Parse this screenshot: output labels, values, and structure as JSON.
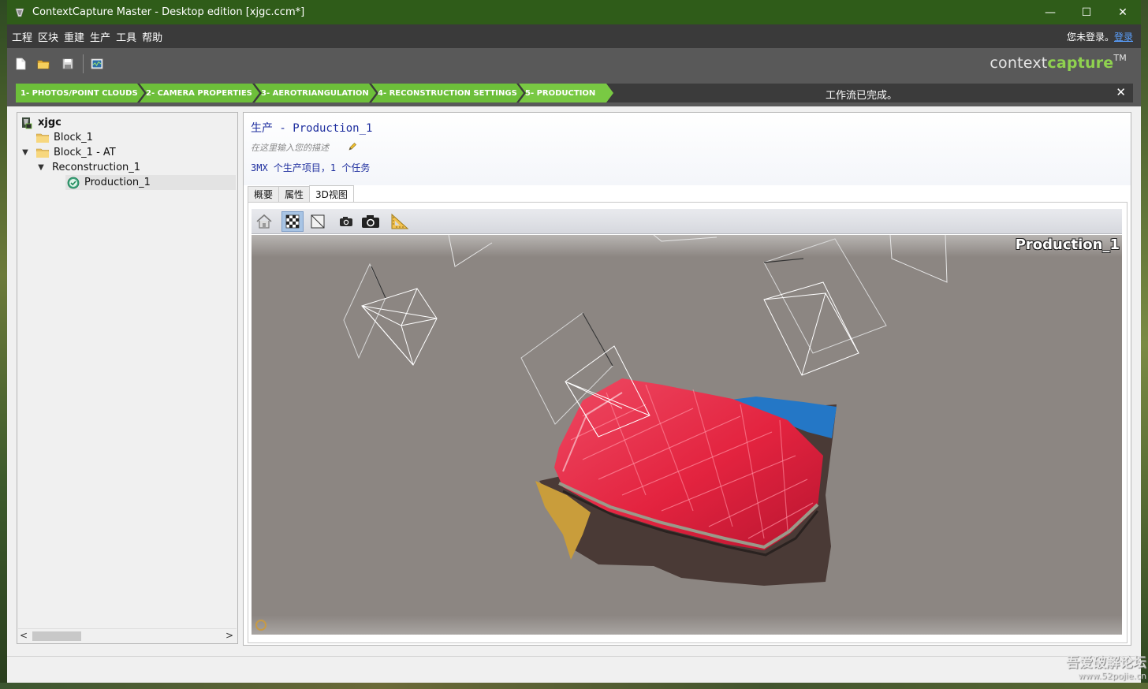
{
  "window": {
    "title": "ContextCapture Master - Desktop edition [xjgc.ccm*]",
    "controls": {
      "minimize": "—",
      "maximize": "☐",
      "close": "✕"
    }
  },
  "menu": {
    "items": [
      {
        "label": "工程"
      },
      {
        "label": "区块"
      },
      {
        "label": "重建"
      },
      {
        "label": "生产"
      },
      {
        "label": "工具"
      },
      {
        "label": "帮助"
      }
    ],
    "login_text": "您未登录。",
    "login_link": "登录"
  },
  "toolbar": {
    "icons": [
      "new-project-icon",
      "open-project-icon",
      "save-project-icon",
      "job-monitor-icon"
    ]
  },
  "brand": {
    "part1": "context",
    "part2": "capture",
    "tm": "TM"
  },
  "workflow": {
    "steps": [
      {
        "label": "1- PHOTOS/POINT CLOUDS"
      },
      {
        "label": "2- CAMERA PROPERTIES"
      },
      {
        "label": "3- AEROTRIANGULATION"
      },
      {
        "label": "4- RECONSTRUCTION SETTINGS"
      },
      {
        "label": "5- PRODUCTION"
      }
    ],
    "status": "工作流已完成。",
    "close": "✕"
  },
  "tree": {
    "root": "xjgc",
    "block1": "Block_1",
    "block1_at": "Block_1 - AT",
    "reconstruction": "Reconstruction_1",
    "production": "Production_1"
  },
  "scrollbar": {
    "left": "<",
    "right": ">"
  },
  "production": {
    "title": "生产 - Production_1",
    "description_placeholder": "在这里输入您的描述",
    "summary": "3MX 个生产项目，1 个任务"
  },
  "tabs": [
    {
      "label": "概要",
      "active": false
    },
    {
      "label": "属性",
      "active": false
    },
    {
      "label": "3D视图",
      "active": true
    }
  ],
  "view3d": {
    "label": "Production_1",
    "tools": [
      "home-view-icon",
      "texture-toggle-icon",
      "wireframe-toggle-icon",
      "small-camera-icon",
      "camera-icon",
      "measure-icon"
    ]
  },
  "watermark": {
    "line1": "吾爱破解论坛",
    "line2": "www.52pojie.cn"
  },
  "colors": {
    "titlebar": "#2f5c19",
    "accent_green": "#6dbf3a",
    "menubar": "#3a3a3a",
    "toolbar": "#595959",
    "link_blue": "#1f2f9f",
    "viewport": "#8c8682"
  }
}
